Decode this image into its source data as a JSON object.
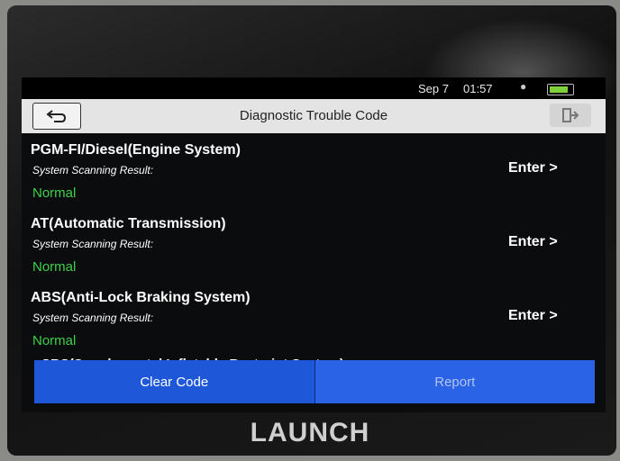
{
  "status_bar": {
    "date": "Sep 7",
    "time": "01:57"
  },
  "title_bar": {
    "title": "Diagnostic Trouble Code"
  },
  "systems": [
    {
      "name": "PGM-FI/Diesel(Engine System)",
      "result_label": "System Scanning Result:",
      "status": "Normal",
      "enter_label": "Enter >"
    },
    {
      "name": "AT(Automatic Transmission)",
      "result_label": "System Scanning Result:",
      "status": "Normal",
      "enter_label": "Enter >"
    },
    {
      "name": "ABS(Anti-Lock Braking System)",
      "result_label": "System Scanning Result:",
      "status": "Normal",
      "enter_label": "Enter >"
    }
  ],
  "partial_system": {
    "name": "SRS(Supplemental Inflatable Restraint System)"
  },
  "actions": {
    "clear_code": "Clear Code",
    "report": "Report"
  },
  "brand": "LAUNCH",
  "colors": {
    "normal_status": "#3fd14a",
    "action_bar": "#1f57d9",
    "title_bar": "#e4e4e4"
  },
  "icons": {
    "back": "back-arrow-icon",
    "exit": "exit-icon",
    "wifi": "wifi-icon",
    "battery": "battery-icon"
  }
}
